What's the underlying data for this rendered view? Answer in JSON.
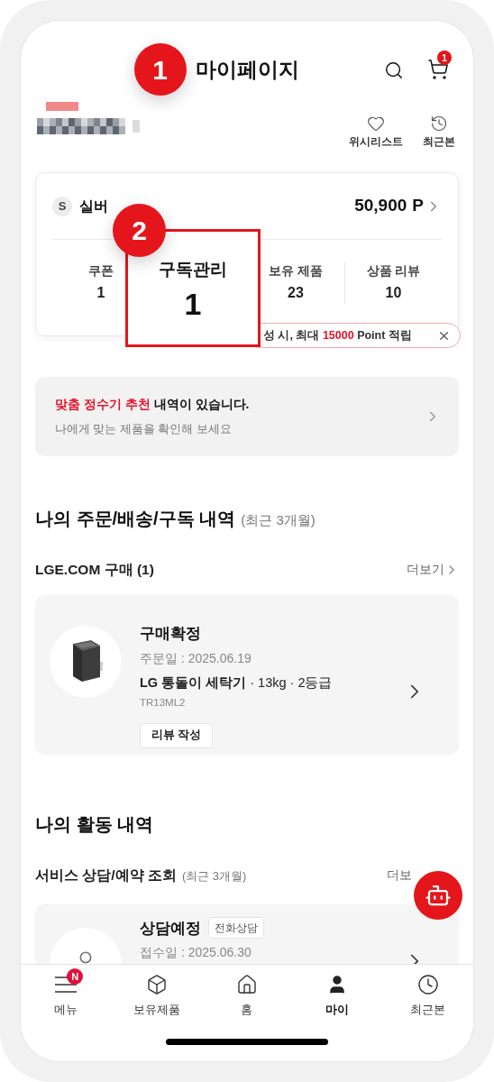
{
  "header": {
    "title": "마이페이지",
    "step_marker": "1",
    "cart_badge": "1"
  },
  "profile_links": [
    {
      "label": "위시리스트"
    },
    {
      "label": "최근본"
    }
  ],
  "membership": {
    "grade_initial": "S",
    "grade": "실버",
    "points": "50,900",
    "points_unit": "P"
  },
  "stats": [
    {
      "label": "쿠폰",
      "value": "1"
    },
    {
      "label": "보유 제품",
      "value": "23"
    },
    {
      "label": "상품 리뷰",
      "value": "10"
    }
  ],
  "tooltip": {
    "text_before": "성 시, 최대 ",
    "highlight": "15000",
    "text_after": " Point 적립"
  },
  "callout": {
    "marker": "2",
    "label": "구독관리",
    "value": "1"
  },
  "banner": {
    "highlight": "맞춤 정수기 추천",
    "title_rest": " 내역이 있습니다.",
    "subtitle": "나에게 맞는 제품을 확인해 보세요"
  },
  "orders": {
    "title": "나의 주문/배송/구독 내역",
    "period": "(최근 3개월)",
    "subheading": "LGE.COM 구매 (1)",
    "more": "더보기",
    "order": {
      "status": "구매확정",
      "date": "주문일 : 2025.06.19",
      "product": "**LG 통돌이 세탁기** · 13kg · 2등급",
      "model": "TR13ML2",
      "action": "리뷰 작성"
    }
  },
  "activity": {
    "title": "나의 활동 내역",
    "subheading": "서비스 상담/예약 조회",
    "period": "(최근 3개월)",
    "more": "더보",
    "item": {
      "status": "상담예정",
      "tag": "전화상담",
      "date": "접수일 : 2025.06.30"
    }
  },
  "bottom_nav": [
    {
      "label": "메뉴",
      "badge": "N",
      "selected": false
    },
    {
      "label": "보유제품",
      "selected": false
    },
    {
      "label": "홈",
      "selected": false
    },
    {
      "label": "마이",
      "selected": true
    },
    {
      "label": "최근본",
      "selected": false
    }
  ]
}
